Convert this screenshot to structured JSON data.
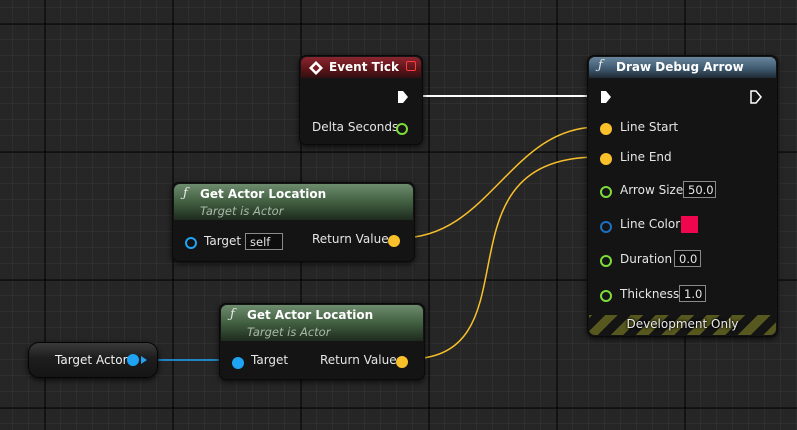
{
  "event_tick": {
    "title": "Event Tick",
    "icon": "event-diamond-icon",
    "accent_color": "#c0202f",
    "outputs": [
      {
        "label": "Delta Seconds",
        "pin_color": "#7cdc3a"
      }
    ]
  },
  "get_location_1": {
    "func_symbol": "ƒ",
    "title": "Get Actor Location",
    "subtitle": "Target is Actor",
    "target_label": "Target",
    "target_value": "self",
    "return_label": "Return Value"
  },
  "get_location_2": {
    "func_symbol": "ƒ",
    "title": "Get Actor Location",
    "subtitle": "Target is Actor",
    "target_label": "Target",
    "return_label": "Return Value"
  },
  "variable": {
    "label": "Target Actor",
    "pin_color": "#1fa3f2"
  },
  "draw_debug_arrow": {
    "func_symbol": "ƒ",
    "title": "Draw Debug Arrow",
    "inputs": [
      {
        "label": "Line Start"
      },
      {
        "label": "Line End"
      },
      {
        "label": "Arrow Size",
        "value": "50.0"
      },
      {
        "label": "Line Color",
        "color": "#f0054f"
      },
      {
        "label": "Duration",
        "value": "0.0"
      },
      {
        "label": "Thickness",
        "value": "1.0"
      }
    ],
    "footer": "Development Only"
  },
  "colors": {
    "vector_pin": "#f8c02b",
    "float_pin": "#7cdc3a",
    "object_pin": "#1fa3f2",
    "linear_color_pin": "#1c6fc0",
    "exec_wire": "#ffffff"
  }
}
